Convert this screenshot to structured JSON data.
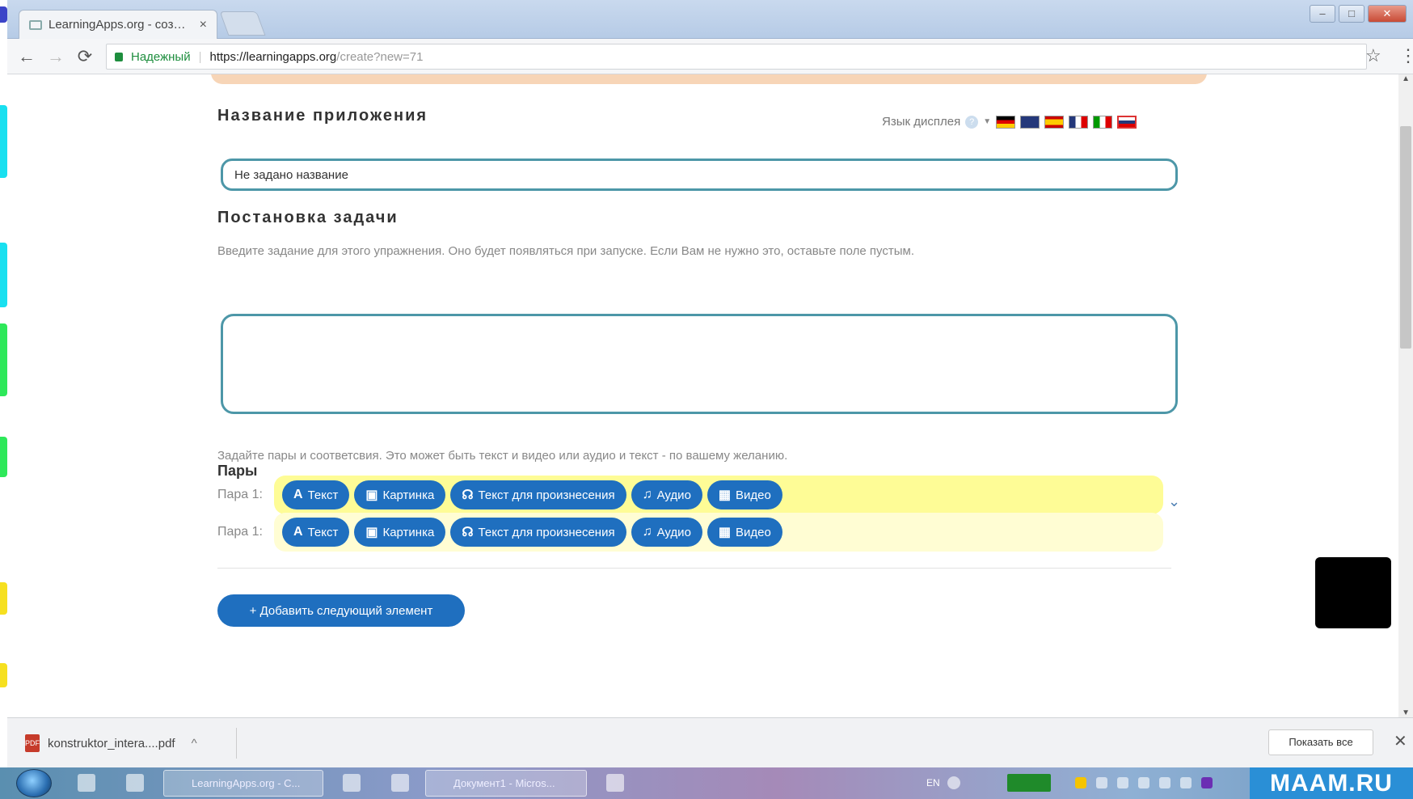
{
  "browser": {
    "tab_title": "LearningApps.org - coз…",
    "tab_close": "×",
    "secure_label": "Надежный",
    "separator": "|",
    "url_host": "https://learningapps.org",
    "url_path": "/create?new=71",
    "window_buttons": [
      "–",
      "□",
      "✕"
    ]
  },
  "page": {
    "app_name_heading": "Название приложения",
    "display_language_label": "Язык дисплея",
    "app_name_value": "Не задано название",
    "task_heading": "Постановка задачи",
    "task_description": "Введите задание для этого упражнения. Оно будет появляться при запуске. Если Вам не нужно это, оставьте поле пустым.",
    "pairs_heading": "Пары",
    "pairs_description": "Задайте пары и соответсвия. Это может быть текст и видео или аудио и текст - по вашему желанию.",
    "pairs": [
      {
        "label": "Пара 1:",
        "buttons": [
          "Текст",
          "Картинка",
          "Текст для произнесения",
          "Аудио",
          "Видео"
        ]
      },
      {
        "label": "Пара 1:",
        "buttons": [
          "Текст",
          "Картинка",
          "Текст для произнесения",
          "Аудио",
          "Видео"
        ]
      }
    ],
    "button_icons": [
      "A",
      "▣",
      "☊",
      "♫",
      "▦"
    ],
    "add_button": "+ Добавить следующий элемент"
  },
  "downloads": {
    "file_name": "konstruktor_intera....pdf",
    "show_all": "Показать все",
    "close": "✕"
  },
  "taskbar": {
    "task1": "LearningApps.org - C...",
    "task2": "Документ1 - Micros...",
    "lang": "EN",
    "brand": "MAAM.RU"
  },
  "colors": {
    "accent_blue": "#1f6fbf",
    "input_border": "#4d97a8",
    "pair_bar_active": "#fefc96",
    "pair_bar_inactive": "#fffdd3",
    "top_band": "#f7d5b7",
    "brand_blue": "#2a8fd6"
  }
}
